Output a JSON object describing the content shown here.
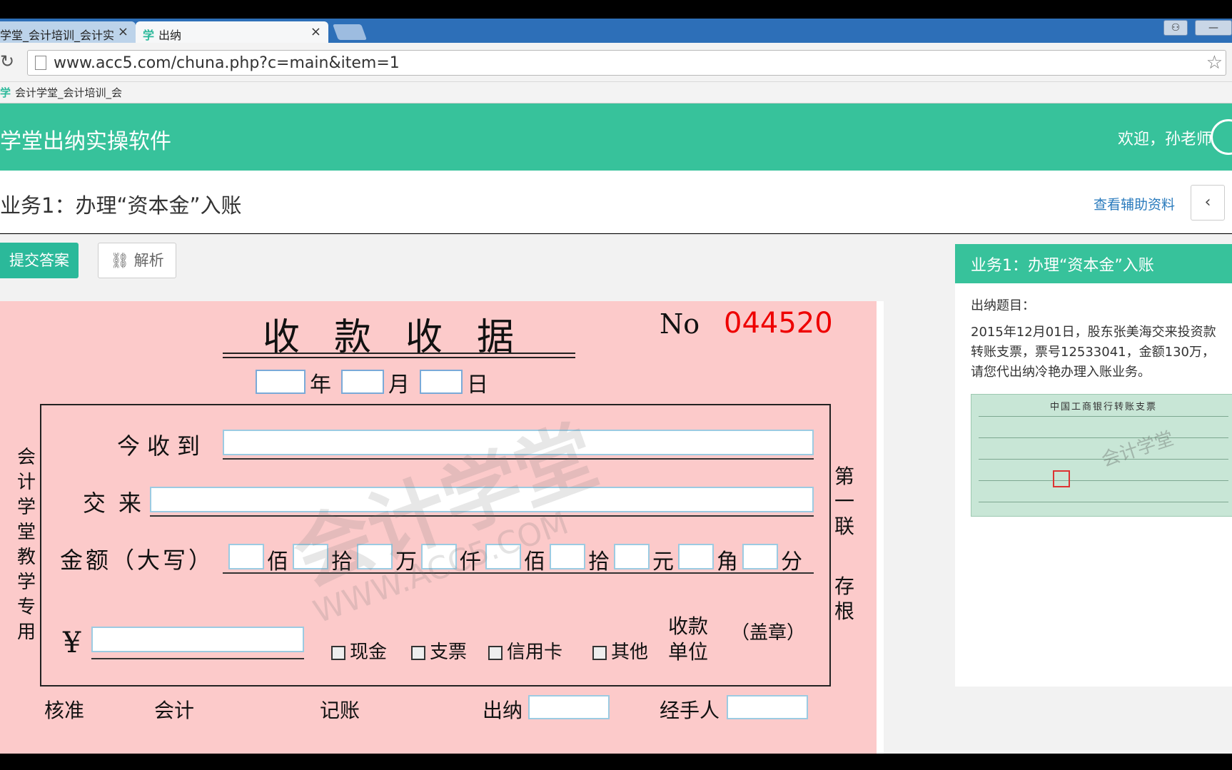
{
  "browser": {
    "tabs": [
      {
        "label": "学堂_会计培训_会计实",
        "active": false
      },
      {
        "label": "出纳",
        "active": true
      }
    ],
    "tab_icon": "学",
    "url": "www.acc5.com/chuna.php?c=main&item=1",
    "bookmark": "会计学堂_会计培训_会",
    "bookmark_icon": "学"
  },
  "header": {
    "app_title": "学堂出纳实操软件",
    "welcome": "欢迎，孙老师"
  },
  "task": {
    "title": "业务1：办理“资本金”入账",
    "aux_link": "查看辅助资料",
    "prev_button": "‹"
  },
  "toolbar": {
    "submit_label": "提交答案",
    "analysis_label": "解析"
  },
  "receipt": {
    "title": "收款收据",
    "no_label": "No",
    "no_value": "044520",
    "date_labels": {
      "year": "年",
      "month": "月",
      "day": "日"
    },
    "left_vertical": "会计学堂教学专用",
    "right_vertical_top": "第一联",
    "right_vertical_bottom": "存根",
    "received_from_label": "今收到",
    "paid_for_label": "交来",
    "amount_words_label": "金额（大写）",
    "digit_units": [
      "佰",
      "拾",
      "万",
      "仟",
      "佰",
      "拾",
      "元",
      "角",
      "分"
    ],
    "currency_symbol": "¥",
    "payment_methods": [
      "现金",
      "支票",
      "信用卡",
      "其他"
    ],
    "payee_unit_label_line1": "收款",
    "payee_unit_label_line2": "单位",
    "seal_label": "（盖章）",
    "signatures": {
      "approve": "核准",
      "accountant": "会计",
      "bookkeeping": "记账",
      "cashier": "出纳",
      "handler": "经手人"
    }
  },
  "panel": {
    "title": "业务1：办理“资本金”入账",
    "question_label": "出纳题目：",
    "lines": [
      "2015年12月01日，股东张美海交来投资款",
      "转账支票，票号12533041，金额130万，",
      "请您代出纳冷艳办理入账业务。"
    ],
    "check_image": {
      "title": "中国工商银行转账支票",
      "watermark": "会计学堂"
    }
  }
}
